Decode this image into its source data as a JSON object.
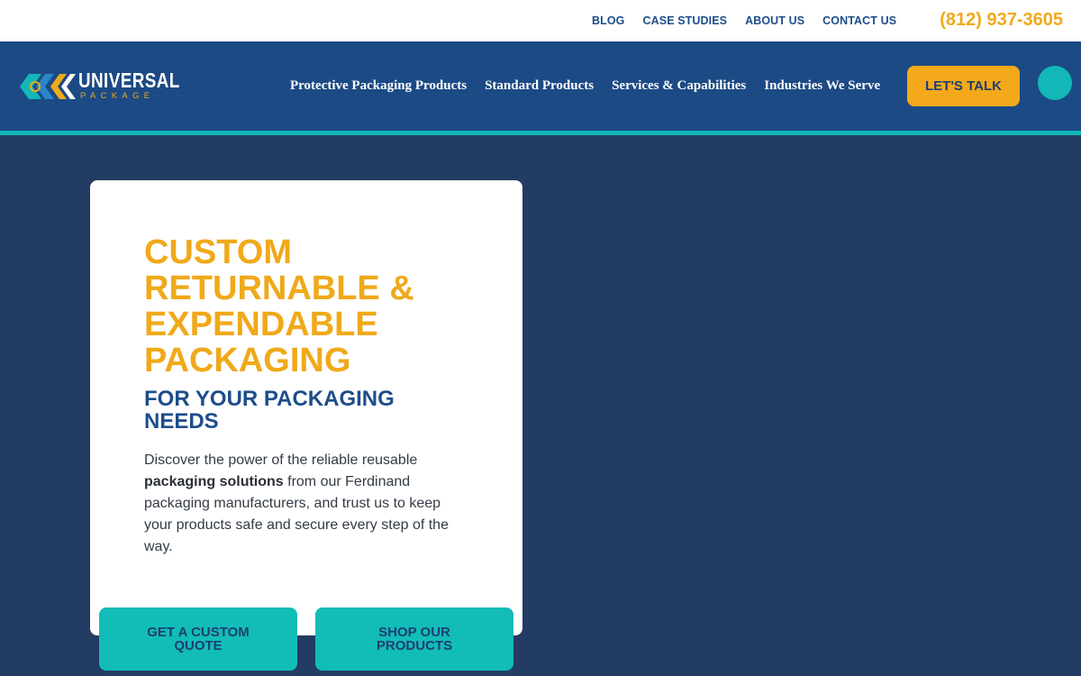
{
  "topbar": {
    "links": [
      "BLOG",
      "CASE STUDIES",
      "ABOUT US",
      "CONTACT US"
    ],
    "phone": "(812) 937-3605"
  },
  "logo": {
    "name": "UNIVERSAL",
    "tagline": "PACKAGE"
  },
  "nav": {
    "items": [
      "Protective Packaging Products",
      "Standard Products",
      "Services & Capabilities",
      "Industries We Serve"
    ],
    "cta": "LET'S TALK"
  },
  "hero": {
    "headline": "CUSTOM RETURNABLE & EXPENDABLE PACKAGING",
    "subheadline": "FOR YOUR PACKAGING NEEDS",
    "desc_before": "Discover the power of the reliable reusable ",
    "desc_bold": "packaging solutions",
    "desc_after": " from our Ferdinand packaging manufacturers, and trust us to keep your products safe and secure every step of the way.",
    "button_quote": "GET A CUSTOM QUOTE",
    "button_shop": "SHOP OUR PRODUCTS"
  },
  "colors": {
    "accent_orange": "#f0a91a",
    "brand_blue": "#1c4a84",
    "teal": "#12b8b7",
    "background": "#233c63"
  }
}
